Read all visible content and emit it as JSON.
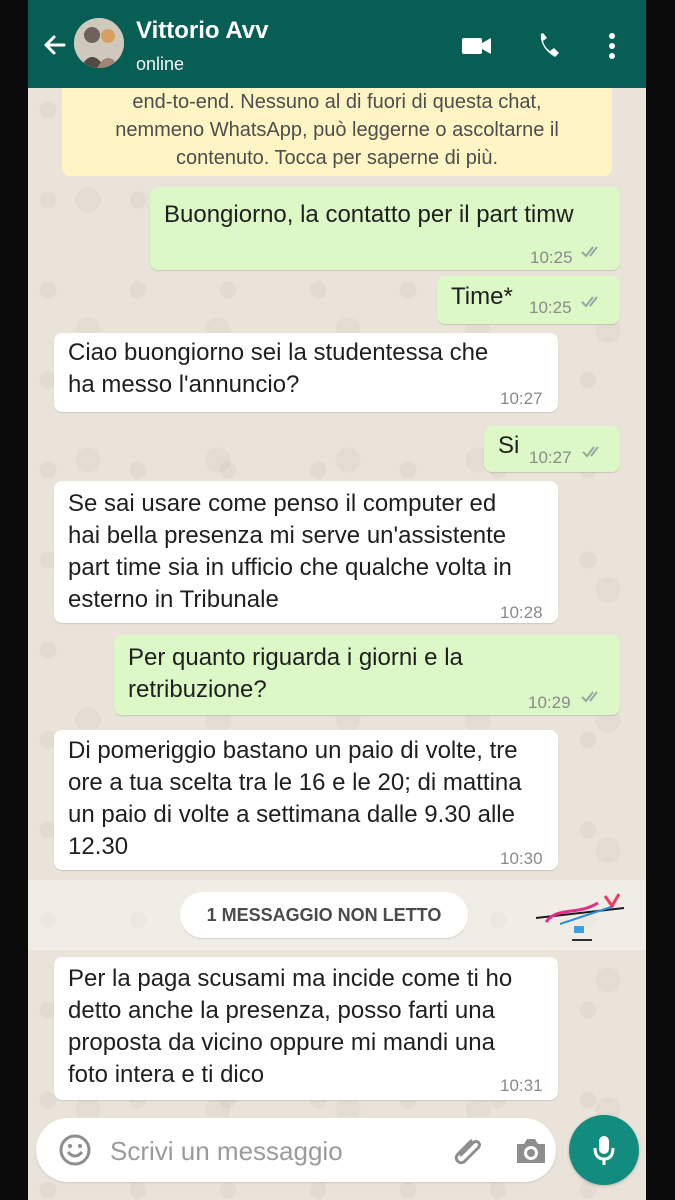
{
  "header": {
    "contact_name": "Vittorio Avv",
    "status": "online"
  },
  "notice": {
    "lines": [
      "end-to-end. Nessuno al di fuori di questa chat,",
      "nemmeno WhatsApp, può leggerne o ascoltarne il",
      "contenuto. Tocca per saperne di più."
    ]
  },
  "messages": [
    {
      "direction": "out",
      "lines": [
        "Buongiorno, la contatto per il part timw"
      ],
      "time": "10:25",
      "ticks": "double"
    },
    {
      "direction": "out",
      "lines": [
        "Time*"
      ],
      "time": "10:25",
      "ticks": "double"
    },
    {
      "direction": "in",
      "lines": [
        "Ciao buongiorno sei la studentessa che",
        "ha messo l'annuncio?"
      ],
      "time": "10:27"
    },
    {
      "direction": "out",
      "lines": [
        "Si"
      ],
      "time": "10:27",
      "ticks": "double"
    },
    {
      "direction": "in",
      "lines": [
        "Se sai usare come penso il computer ed",
        "hai bella presenza mi serve un'assistente",
        "part time sia in ufficio che qualche volta in",
        "esterno in Tribunale"
      ],
      "time": "10:28"
    },
    {
      "direction": "out",
      "lines": [
        "Per quanto riguarda i giorni e la",
        "retribuzione?"
      ],
      "time": "10:29",
      "ticks": "double"
    },
    {
      "direction": "in",
      "lines": [
        "Di pomeriggio bastano un paio di volte, tre",
        "ore a tua scelta tra le 16 e le 20; di mattina",
        "un paio di volte a settimana dalle 9.30 alle",
        "12.30"
      ],
      "time": "10:30"
    },
    {
      "direction": "in",
      "lines": [
        "Per la paga scusami ma incide come ti ho",
        "detto anche la presenza, posso farti una",
        "proposta da vicino oppure mi mandi una",
        "foto intera e ti dico"
      ],
      "time": "10:31"
    }
  ],
  "unread_banner": "1 MESSAGGIO NON LETTO",
  "composer": {
    "placeholder": "Scrivi un messaggio"
  },
  "colors": {
    "header": "#075e54",
    "outgoing_bubble": "#dcf8c6",
    "incoming_bubble": "#ffffff",
    "notice": "#fff5c4",
    "mic_button": "#128c7e"
  },
  "icons": [
    "back-arrow-icon",
    "video-call-icon",
    "phone-icon",
    "more-options-icon",
    "emoji-icon",
    "attachment-icon",
    "camera-icon",
    "microphone-icon",
    "double-check-icon"
  ]
}
